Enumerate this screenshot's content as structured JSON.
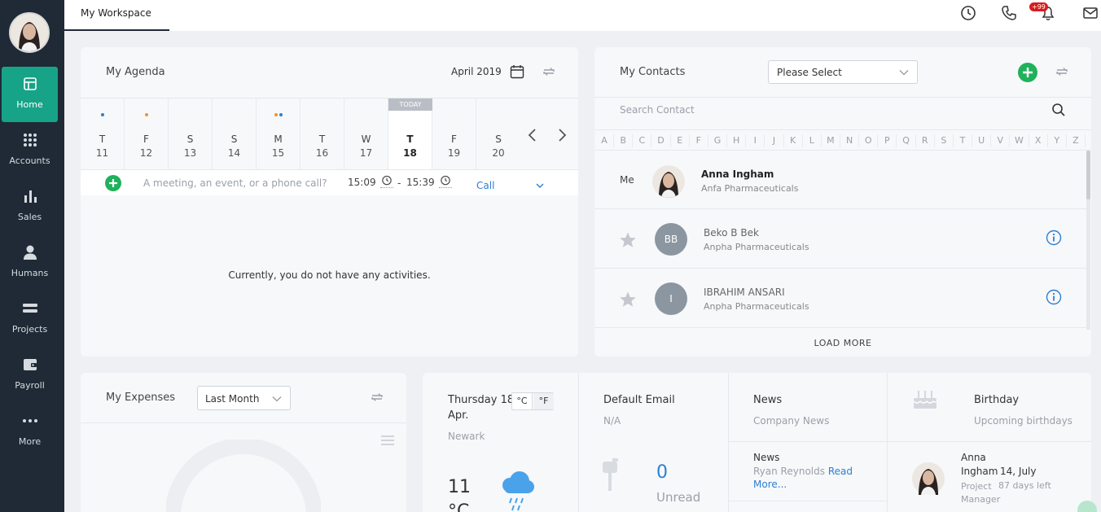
{
  "sidebar": {
    "items": [
      {
        "label": "Home",
        "icon": "home-icon"
      },
      {
        "label": "Accounts",
        "icon": "accounts-icon"
      },
      {
        "label": "Sales",
        "icon": "sales-chart-icon"
      },
      {
        "label": "Humans",
        "icon": "user-icon"
      },
      {
        "label": "Projects",
        "icon": "projects-icon"
      },
      {
        "label": "Payroll",
        "icon": "wallet-icon"
      },
      {
        "label": "More",
        "icon": "more-dots-icon"
      }
    ]
  },
  "topbar": {
    "tab": "My Workspace",
    "notifications_badge": "+99"
  },
  "agenda": {
    "title": "My Agenda",
    "month": "April 2019",
    "today_label": "TODAY",
    "days": [
      {
        "wd": "T",
        "dn": "11"
      },
      {
        "wd": "F",
        "dn": "12"
      },
      {
        "wd": "S",
        "dn": "13"
      },
      {
        "wd": "S",
        "dn": "14"
      },
      {
        "wd": "M",
        "dn": "15"
      },
      {
        "wd": "T",
        "dn": "16"
      },
      {
        "wd": "W",
        "dn": "17"
      },
      {
        "wd": "T",
        "dn": "18"
      },
      {
        "wd": "F",
        "dn": "19"
      },
      {
        "wd": "S",
        "dn": "20"
      }
    ],
    "placeholder": "A meeting, an event, or a phone call?",
    "start_time": "15:09",
    "separator": "-",
    "end_time": "15:39",
    "type": "Call",
    "empty_message": "Currently, you do not have any activities."
  },
  "contacts": {
    "title": "My Contacts",
    "select_placeholder": "Please Select",
    "search_placeholder": "Search Contact",
    "alphabet": [
      "A",
      "B",
      "C",
      "D",
      "E",
      "F",
      "G",
      "H",
      "I",
      "J",
      "K",
      "L",
      "M",
      "N",
      "O",
      "P",
      "Q",
      "R",
      "S",
      "T",
      "U",
      "V",
      "W",
      "X",
      "Y",
      "Z"
    ],
    "me_label": "Me",
    "me": {
      "name": "Anna Ingham",
      "company": "Anfa Pharmaceuticals"
    },
    "list": [
      {
        "initials": "BB",
        "name": "Beko B Bek",
        "company": "Anpha Pharmaceuticals"
      },
      {
        "initials": "I",
        "name": "IBRAHIM ANSARI",
        "company": "Anpha Pharmaceuticals"
      }
    ],
    "load_more": "LOAD MORE"
  },
  "expenses": {
    "title": "My Expenses",
    "period": "Last Month"
  },
  "weather": {
    "date_line1": "Thursday 18",
    "date_line2": "Apr.",
    "unit_c": "°C",
    "unit_f": "°F",
    "city": "Newark",
    "temp": "11",
    "temp_unit_partial": "°C"
  },
  "email": {
    "title": "Default Email",
    "value": "N/A",
    "unread_count": "0",
    "unread_label": "Unread"
  },
  "news": {
    "title": "News",
    "subtitle": "Company News",
    "item_title": "News",
    "item_author": "Ryan Reynolds",
    "item_link1": "Read",
    "item_link2": "More..."
  },
  "birthday": {
    "title": "Birthday",
    "subtitle": "Upcoming birthdays",
    "person_first": "Anna",
    "person_last": "Ingham",
    "date": "14, July",
    "role_line1": "Project",
    "role_line2": "Manager",
    "days_left": "87 days left"
  },
  "colors": {
    "accent": "#17a388",
    "sidebar": "#1f2a36",
    "green": "#1fb25a",
    "info": "#2d7fd3"
  }
}
